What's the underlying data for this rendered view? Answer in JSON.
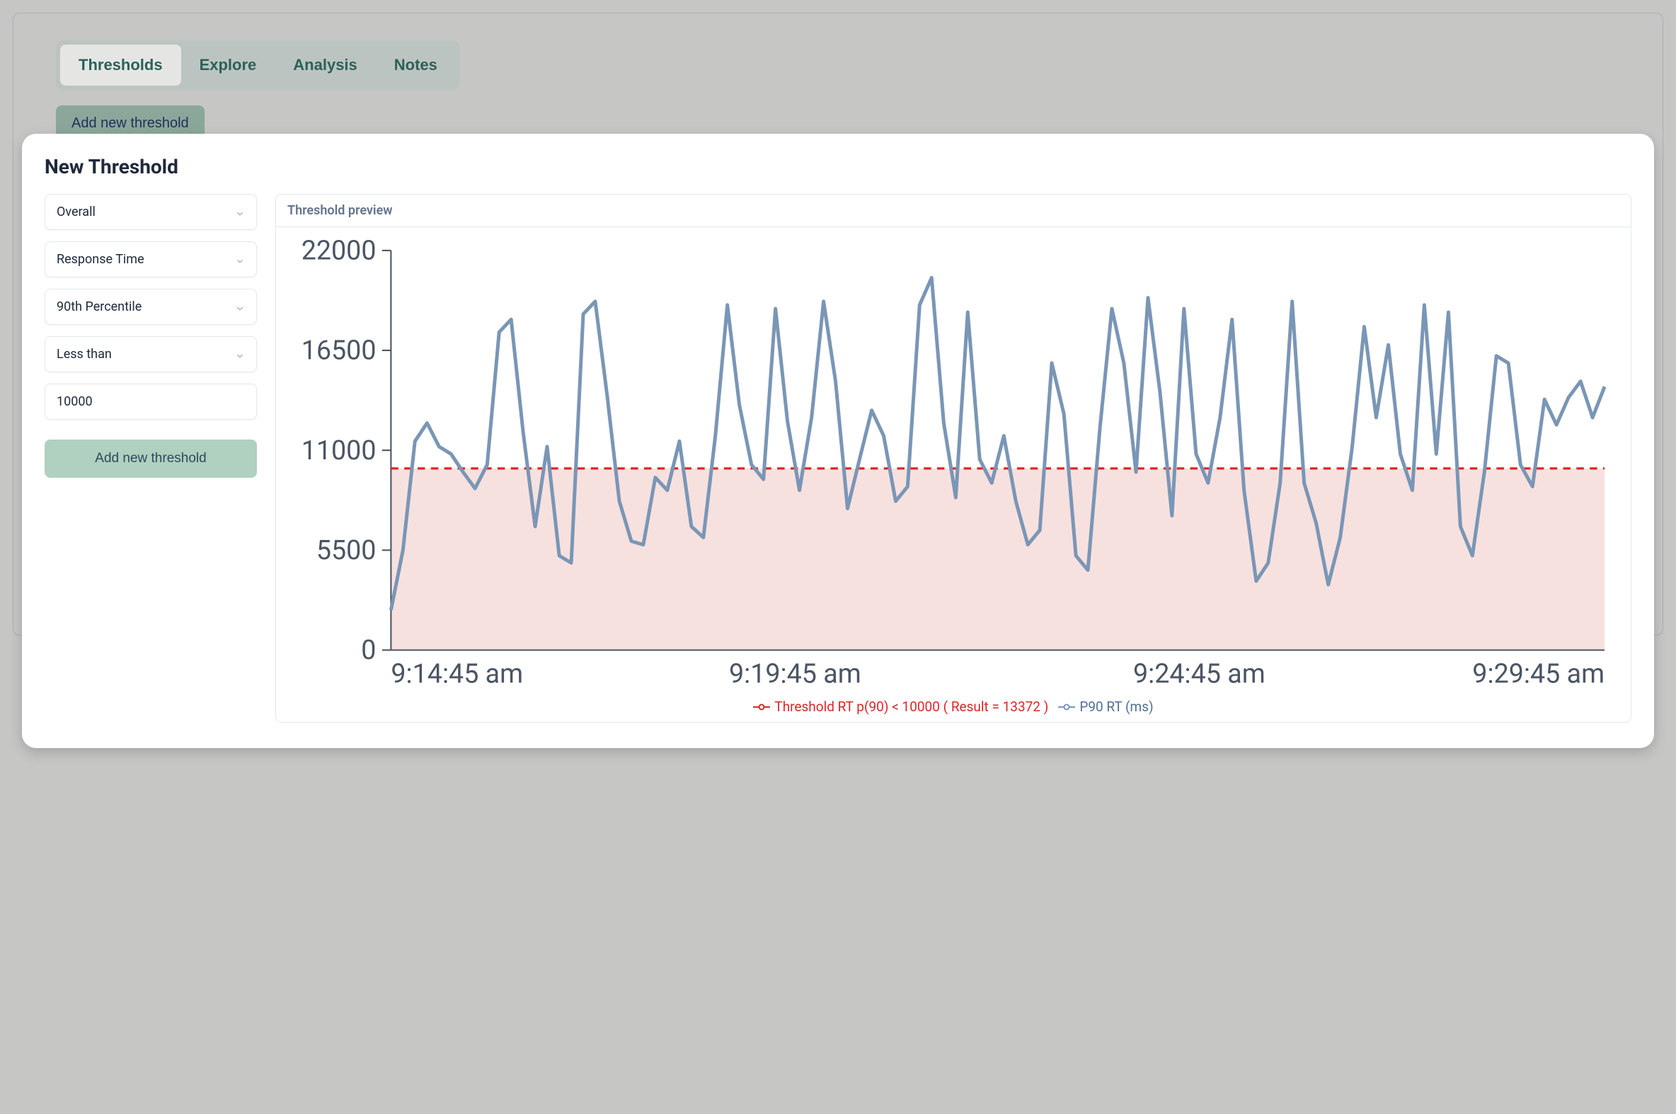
{
  "tabs": {
    "items": [
      "Thresholds",
      "Explore",
      "Analysis",
      "Notes"
    ],
    "active_index": 0
  },
  "top_button": {
    "label": "Add new threshold"
  },
  "modal": {
    "title": "New Threshold",
    "fields": {
      "scope": {
        "value": "Overall"
      },
      "metric": {
        "value": "Response Time"
      },
      "agg": {
        "value": "90th Percentile"
      },
      "compare": {
        "value": "Less than"
      },
      "value": {
        "value": "10000"
      }
    },
    "submit_label": "Add new threshold"
  },
  "preview": {
    "header": "Threshold preview",
    "legend": {
      "threshold": "Threshold RT p(90) < 10000 ( Result = 13372 )",
      "series": "P90 RT (ms)"
    },
    "colors": {
      "threshold_line": "#dc2626",
      "threshold_fill": "#f6dcd9",
      "series_line": "#7a96b6",
      "axis": "#4b5563"
    }
  },
  "chart_data": {
    "type": "line",
    "title": "Threshold preview",
    "xlabel": "",
    "ylabel": "",
    "ylim": [
      0,
      22000
    ],
    "y_ticks": [
      0,
      5500,
      11000,
      16500,
      22000
    ],
    "x_tick_labels": [
      "9:14:45 am",
      "9:19:45 am",
      "9:24:45 am",
      "9:29:45 am"
    ],
    "x_tick_positions": [
      0,
      33.3,
      66.6,
      100
    ],
    "threshold_value": 10000,
    "series": [
      {
        "name": "P90 RT (ms)",
        "values": [
          2200,
          5500,
          11500,
          12500,
          11200,
          10800,
          9800,
          8900,
          10200,
          17500,
          18200,
          12000,
          6800,
          11200,
          5200,
          4800,
          18500,
          19200,
          14000,
          8200,
          6000,
          5800,
          9500,
          8800,
          11500,
          6800,
          6200,
          11800,
          19000,
          13500,
          10200,
          9400,
          18800,
          12600,
          8800,
          12800,
          19200,
          14800,
          7800,
          10500,
          13200,
          11800,
          8200,
          9000,
          19000,
          20500,
          12500,
          8400,
          18600,
          10500,
          9200,
          11800,
          8200,
          5800,
          6600,
          15800,
          13000,
          5200,
          4400,
          12200,
          18800,
          15800,
          9800,
          19400,
          14200,
          7400,
          18800,
          10800,
          9200,
          12800,
          18200,
          8800,
          3800,
          4800,
          9200,
          19200,
          9200,
          7000,
          3600,
          6200,
          11200,
          17800,
          12800,
          16800,
          10800,
          8800,
          19000,
          10800,
          18600,
          6800,
          5200,
          9800,
          16200,
          15800,
          10200,
          9000,
          13800,
          12400,
          13900,
          14800,
          12800,
          14500
        ]
      }
    ]
  }
}
